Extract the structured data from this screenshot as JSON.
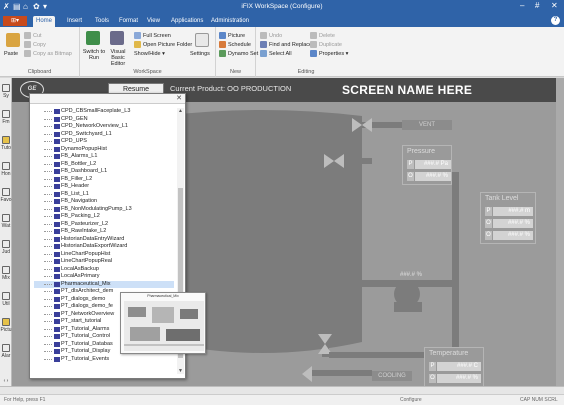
{
  "titlebar": {
    "title": "iFIX WorkSpace (Configure)",
    "quick_access_icons": [
      "fix-logo-icon",
      "save-icon",
      "home-icon",
      "settings-icon",
      "menu-icon"
    ],
    "controls": [
      "–",
      "#",
      "✕"
    ]
  },
  "menu": {
    "file_label": "⊞▾",
    "tabs": [
      "Home",
      "Insert",
      "Tools",
      "Format",
      "View",
      "Applications",
      "Administration"
    ],
    "active_tab": "Home",
    "help_label": "?"
  },
  "ribbon": {
    "clipboard": {
      "label": "Clipboard",
      "paste_label": "Paste",
      "cut_label": "Cut",
      "copy_label": "Copy",
      "copy_bitmap_label": "Copy as Bitmap"
    },
    "workspace": {
      "label": "WorkSpace",
      "switch_label": "Switch to Run",
      "visual_basic_label": "Visual Basic Editor",
      "full_screen_label": "Full Screen",
      "open_picture_folder_label": "Open Picture Folder",
      "show_hide_label": "Show/Hide ▾",
      "settings_label": "Settings"
    },
    "new": {
      "label": "New",
      "picture_label": "Picture",
      "schedule_label": "Schedule",
      "dynamo_set_label": "Dynamo Set"
    },
    "editing": {
      "label": "Editing",
      "undo_label": "Undo",
      "find_replace_label": "Find and Replace",
      "select_all_label": "Select All",
      "delete_label": "Delete",
      "duplicate_label": "Duplicate",
      "properties_label": "Properties ▾"
    }
  },
  "leftbar": {
    "items": [
      "Sy",
      "Fm",
      "Tuto",
      "Hon",
      "Favo",
      "Wat",
      "Jud",
      "Mix",
      "Util",
      "Pictu",
      "Alar"
    ],
    "scroll_label": "‹ ›"
  },
  "canvas": {
    "logo_text": "GE",
    "resume_label": "Resume",
    "current_product_label": "Current Product:",
    "current_product_value": "OO PRODUCTION",
    "screen_name": "SCREEN NAME HERE"
  },
  "process": {
    "vent_label": "VENT",
    "cooling_label": "COOLING",
    "pressure": {
      "title": "Pressure",
      "rows": [
        {
          "tag": "P",
          "value": "###.# Pa"
        },
        {
          "tag": "O",
          "value": "###.# %"
        }
      ]
    },
    "tank_level": {
      "title": "Tank Level",
      "rows": [
        {
          "tag": "P",
          "value": "###.# m"
        },
        {
          "tag": "O",
          "value": "###.# %"
        },
        {
          "tag": "O",
          "value": "###.# %"
        }
      ]
    },
    "temperature": {
      "title": "Temperature",
      "rows": [
        {
          "tag": "P",
          "value": "###.# C"
        },
        {
          "tag": "O",
          "value": "###.# %"
        }
      ]
    },
    "pump_value": "###.# %"
  },
  "explorer": {
    "close_label": "✕",
    "items": [
      "CPD_CBSmallFaceplate_L3",
      "CPD_GEN",
      "CPD_NetworkOverview_L1",
      "CPD_Switchyard_L1",
      "CPD_UPS",
      "DynamoPopupHist",
      "FB_Alarms_L1",
      "FB_Bottler_L2",
      "FB_Dashboard_L1",
      "FB_Filler_L2",
      "FB_Header",
      "FB_List_L1",
      "FB_Navigation",
      "FB_NonModulatingPump_L3",
      "FB_Packing_L2",
      "FB_Pasteurizer_L2",
      "FB_RawIntake_L2",
      "HistorianDataEntryWizard",
      "HistorianDataExportWizard",
      "LineChartPopupHist",
      "LineChartPopupReal",
      "LocalAsBackup",
      "LocalAsPrimary",
      "Pharmaceutical_Mix",
      "PT_dlsArchitect_dem",
      "PT_dialogs_demo",
      "PT_dialogs_demo_fe",
      "PT_NetworkOverview",
      "PT_start_tutorial",
      "PT_Tutorial_Alarms",
      "PT_Tutorial_Control",
      "PT_Tutorial_Databas",
      "PT_Tutorial_Display",
      "PT_Tutorial_Events"
    ],
    "selected_index": 23,
    "preview_title": "Pharmaceutical_Mix"
  },
  "statusbar": {
    "left": "For Help, press F1",
    "center": "Configure",
    "right": "CAP NUM SCRL"
  },
  "colors": {
    "titlebar": "#2f63a8",
    "file_button": "#c84a1c",
    "canvas_bg": "#9b9b9b",
    "pipe": "#7c7c7c",
    "panel_value": "#d3d3d3"
  }
}
